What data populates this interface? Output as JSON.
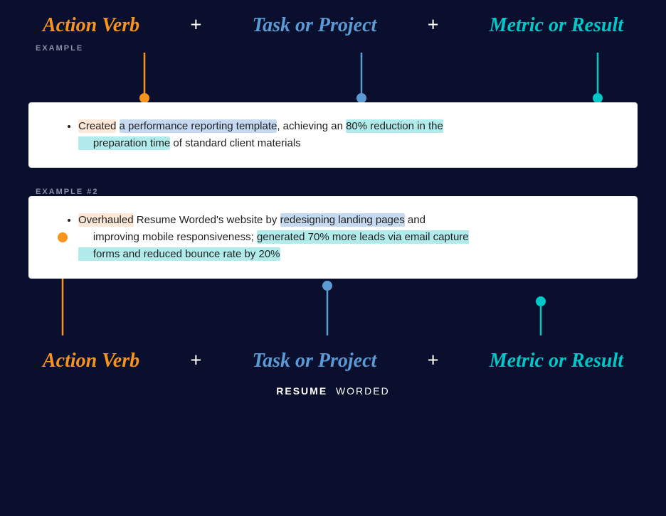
{
  "header": {
    "action_verb_label": "Action Verb",
    "plus1": "+",
    "task_label": "Task or Project",
    "plus2": "+",
    "metric_label": "Metric or Result"
  },
  "example1": {
    "section_label": "EXAMPLE",
    "bullet": "Created a performance reporting template, achieving an 80% reduction in the preparation time of standard client materials",
    "action_text": "Created",
    "task_text": "a performance reporting template",
    "metric_text": "80% reduction in the preparation time"
  },
  "example2": {
    "section_label": "EXAMPLE #2",
    "bullet_line1": "Overhauled Resume Worded's website by redesigning landing pages and",
    "bullet_line2": "improving mobile responsiveness; generated 70% more leads via email capture",
    "bullet_line3": "forms and reduced bounce rate by 20%",
    "action_text": "Overhauled",
    "task_text": "redesigning landing pages and improving mobile responsiveness",
    "metric_text": "generated 70% more leads via email capture forms and reduced bounce rate by 20%"
  },
  "branding": {
    "resume": "RESUME",
    "worded": "WORDED"
  },
  "colors": {
    "orange": "#f7941d",
    "blue": "#5b9bd5",
    "teal": "#00c8c8",
    "background": "#0a0f2e"
  }
}
